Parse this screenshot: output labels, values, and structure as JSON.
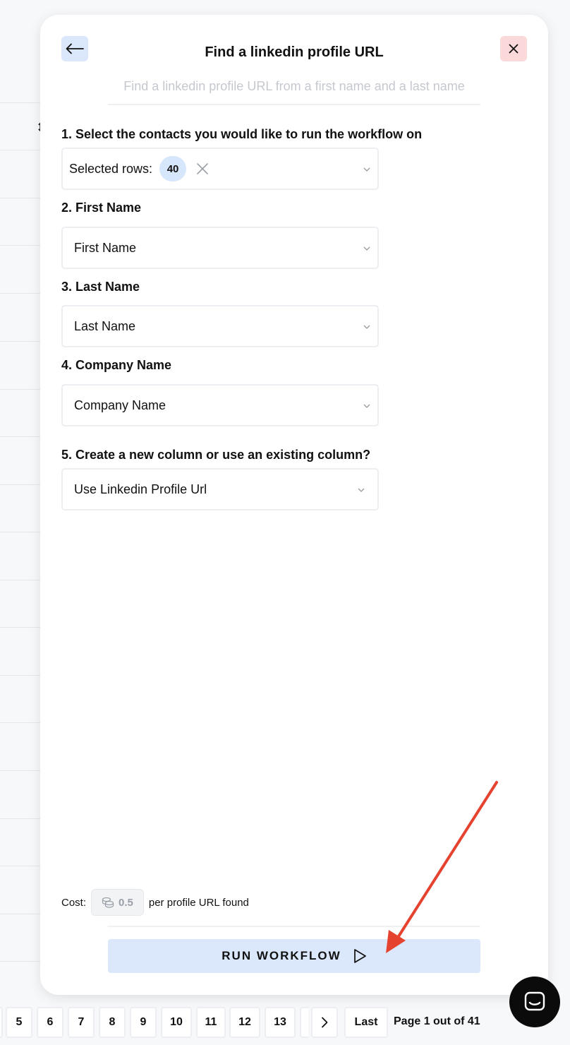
{
  "background": {
    "sort_icon": "sort-arrows-icon"
  },
  "modal": {
    "title": "Find a linkedin profile URL",
    "subtitle": "Find a linkedin profile URL from a first name and a last name",
    "back_icon": "arrow-left-icon",
    "close_icon": "close-icon"
  },
  "fields": {
    "contacts": {
      "label": "1. Select the contacts you would like to run the workflow on",
      "prefix": "Selected rows:",
      "count": "40"
    },
    "first_name": {
      "label": "2. First Name",
      "value": "First Name"
    },
    "last_name": {
      "label": "3. Last Name",
      "value": "Last Name"
    },
    "company_name": {
      "label": "4. Company Name",
      "value": "Company Name"
    },
    "column": {
      "label": "5. Create a new column or use an existing column?",
      "value": "Use Linkedin Profile Url"
    }
  },
  "cost": {
    "label": "Cost:",
    "amount": "0.5",
    "suffix": "per profile URL found",
    "icon": "coins-icon"
  },
  "run_button": {
    "label": "RUN WORKFLOW",
    "icon": "play-icon"
  },
  "pagination": {
    "pages": [
      "5",
      "6",
      "7",
      "8",
      "9",
      "10",
      "11",
      "12",
      "13"
    ],
    "last_label": "Last",
    "info": "Page 1 out of 41"
  },
  "colors": {
    "accent_blue": "#dbe8fb",
    "close_red": "#fbd8da",
    "annotation_arrow": "#e5432f"
  }
}
